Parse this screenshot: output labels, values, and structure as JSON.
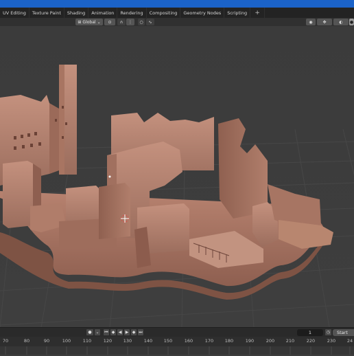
{
  "workspace_tabs": [
    "UV Editing",
    "Texture Paint",
    "Shading",
    "Animation",
    "Rendering",
    "Compositing",
    "Geometry Nodes",
    "Scripting"
  ],
  "add_tab": "+",
  "viewport_header": {
    "orientation": "Global"
  },
  "timeline": {
    "current_frame": "1",
    "start_label": "Start",
    "ruler": [
      "70",
      "80",
      "90",
      "100",
      "110",
      "120",
      "130",
      "140",
      "150",
      "160",
      "170",
      "180",
      "190",
      "200",
      "210",
      "220",
      "230",
      "24"
    ]
  },
  "colors": {
    "title_bar": "#1b63c9",
    "viewport": "#3d3d3d",
    "model": "#b98471"
  },
  "icons": {
    "pivot": "pivot-icon",
    "snap": "magnet-icon",
    "proportional": "proportional-icon",
    "view": "eye-icon",
    "gizmo": "gizmo-icon",
    "overlays": "overlays-icon",
    "shading": "solid-shading-icon",
    "playback": [
      "jump-start-icon",
      "prev-key-icon",
      "play-reverse-icon",
      "play-icon",
      "next-key-icon",
      "jump-end-icon"
    ]
  }
}
